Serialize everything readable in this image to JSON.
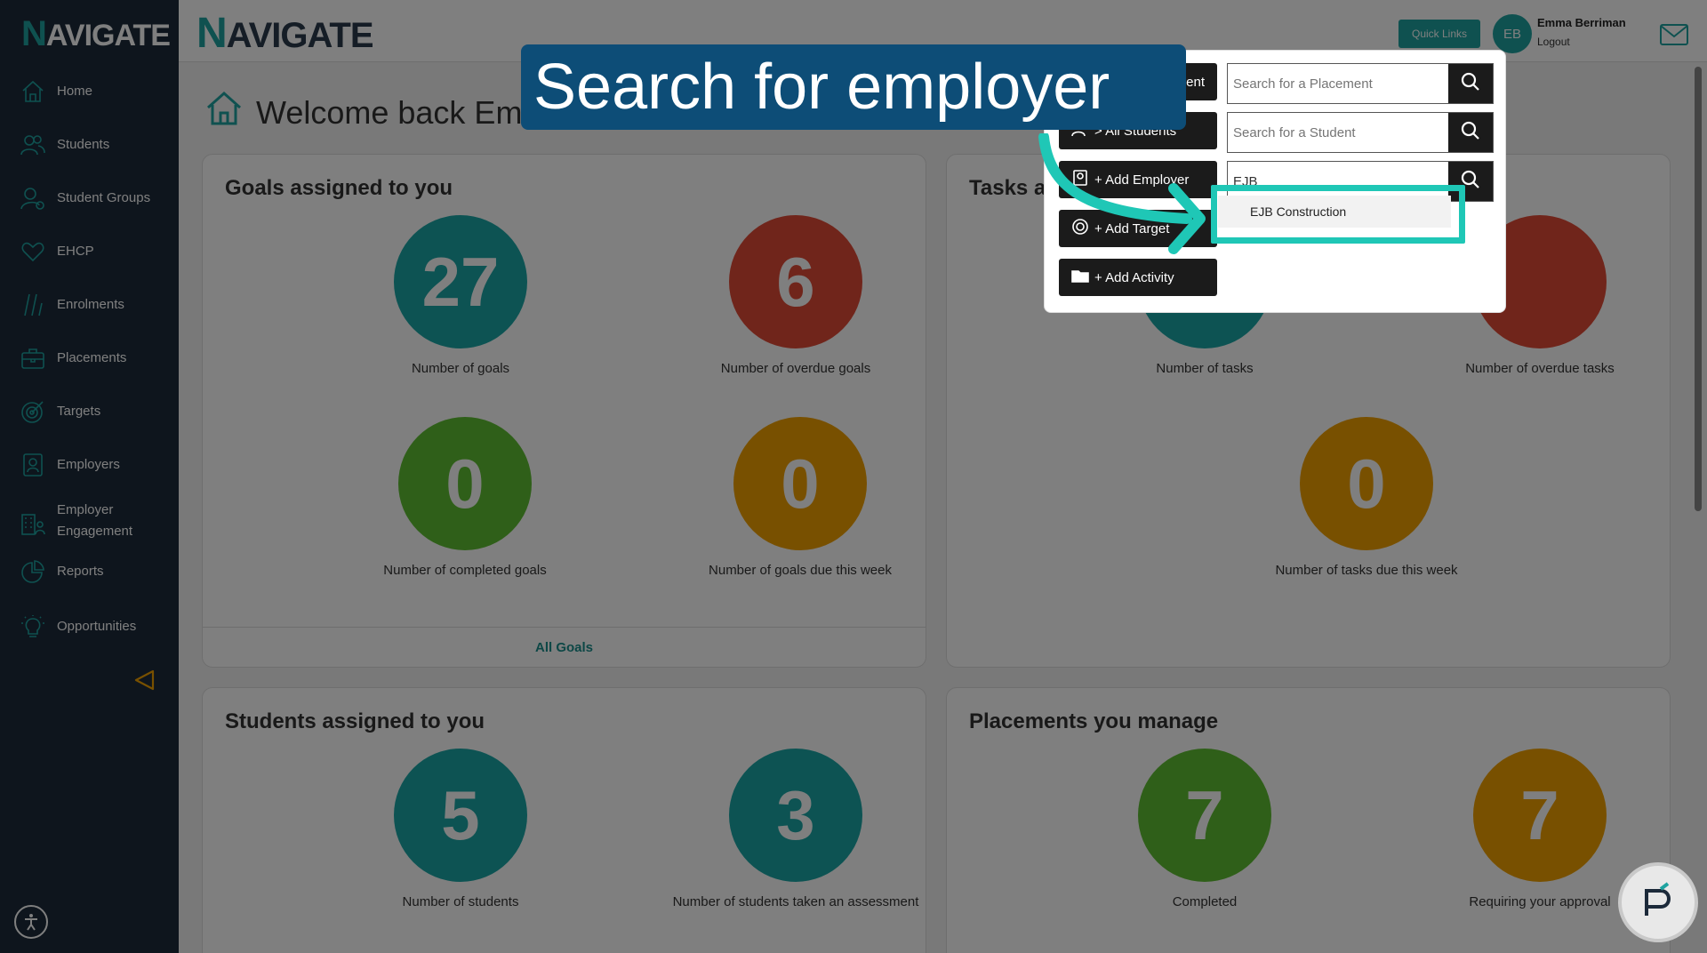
{
  "brand": {
    "logo_n": "N",
    "logo_rest": "AVIGATE"
  },
  "sidebar": {
    "items": [
      {
        "label": "Home",
        "icon": "home-icon"
      },
      {
        "label": "Students",
        "icon": "users-icon"
      },
      {
        "label": "Student Groups",
        "icon": "user-group-icon"
      },
      {
        "label": "EHCP",
        "icon": "heart-icon"
      },
      {
        "label": "Enrolments",
        "icon": "slashes-icon"
      },
      {
        "label": "Placements",
        "icon": "briefcase-icon"
      },
      {
        "label": "Targets",
        "icon": "target-icon"
      },
      {
        "label": "Employers",
        "icon": "id-badge-icon"
      },
      {
        "label": "Employer\nEngagement",
        "icon": "building-icon"
      },
      {
        "label": "Reports",
        "icon": "pie-chart-icon"
      },
      {
        "label": "Opportunities",
        "icon": "lightbulb-icon"
      }
    ]
  },
  "header": {
    "quick_links": "Quick Links",
    "avatar": "EB",
    "user_name": "Emma Berriman",
    "logout": "Logout"
  },
  "main": {
    "welcome": "Welcome back Em",
    "goals": {
      "title": "Goals assigned to you",
      "metrics": [
        {
          "value": "27",
          "caption": "Number of goals",
          "color": "#1aa7a6"
        },
        {
          "value": "6",
          "caption": "Number of overdue goals",
          "color": "#e04a36"
        },
        {
          "value": "0",
          "caption": "Number of completed goals",
          "color": "#5fbf33"
        },
        {
          "value": "0",
          "caption": "Number of goals due this week",
          "color": "#f0a100"
        }
      ],
      "footer": "All Goals"
    },
    "tasks": {
      "title": "Tasks as",
      "metrics": [
        {
          "caption": "Number of tasks"
        },
        {
          "caption": "Number of overdue tasks"
        },
        {
          "value": "0",
          "caption": "Number of tasks due this week"
        }
      ]
    },
    "students": {
      "title": "Students assigned to you",
      "metrics": [
        {
          "value": "5",
          "caption": "Number of students"
        },
        {
          "value": "3",
          "caption": "Number of students taken an assessment"
        }
      ]
    },
    "placements": {
      "title": "Placements you manage",
      "metrics": [
        {
          "value": "7",
          "caption": "Completed"
        },
        {
          "value": "7",
          "caption": "Requiring your approval"
        }
      ]
    }
  },
  "popover": {
    "buttons": [
      {
        "label": "ent"
      },
      {
        "label": "> All Students"
      },
      {
        "label": "+ Add Employer"
      },
      {
        "label": "+ Add Target"
      },
      {
        "label": "+ Add Activity"
      }
    ],
    "search_placement": "Search for a Placement",
    "search_student": "Search for a Student",
    "search_employer_value": "EJB",
    "suggestion": "EJB Construction"
  },
  "banner": "Search for employer"
}
